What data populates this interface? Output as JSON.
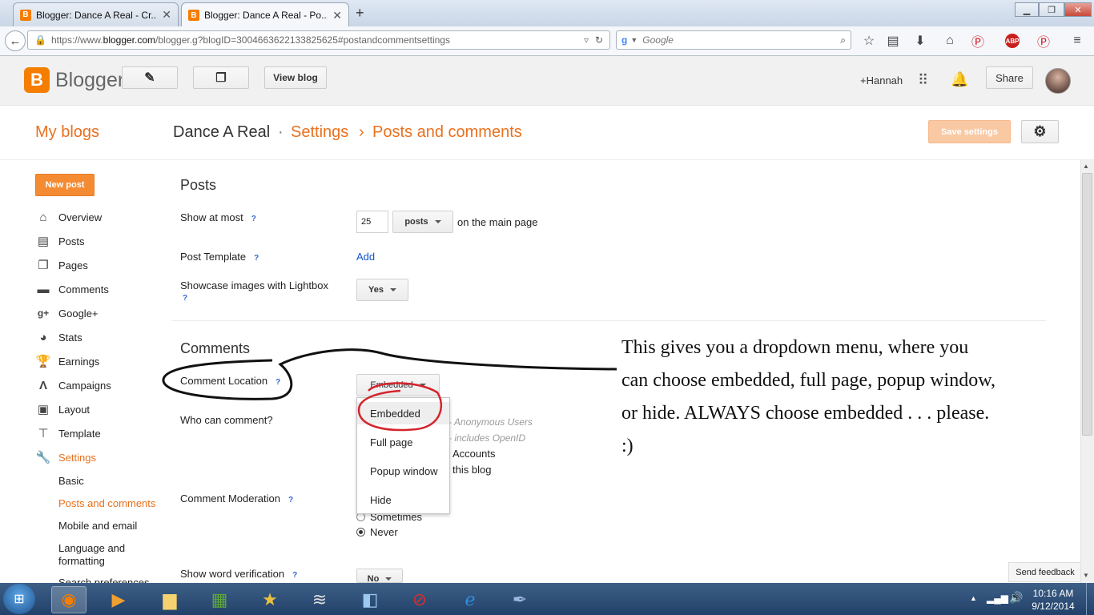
{
  "browser": {
    "tabs": [
      {
        "title": "Blogger: Dance A Real - Cr...",
        "active": false
      },
      {
        "title": "Blogger: Dance A Real - Po...",
        "active": true
      }
    ],
    "new_tab": "+",
    "url_prefix": "https://www.",
    "url_host": "blogger.com",
    "url_rest": "/blogger.g?blogID=3004663622133825625#postandcommentsettings",
    "search_placeholder": "Google"
  },
  "header": {
    "logo_letter": "B",
    "brand": "Blogger",
    "view_blog": "View blog",
    "user": "+Hannah",
    "share": "Share"
  },
  "title_row": {
    "my_blogs": "My blogs",
    "blog_name": "Dance A Real",
    "dot": "·",
    "settings": "Settings",
    "chev": "›",
    "page": "Posts and comments",
    "save": "Save settings"
  },
  "sidebar": {
    "new_post": "New post",
    "items": [
      {
        "label": "Overview",
        "icon": "home-icon"
      },
      {
        "label": "Posts",
        "icon": "posts-icon"
      },
      {
        "label": "Pages",
        "icon": "pages-icon"
      },
      {
        "label": "Comments",
        "icon": "comments-icon"
      },
      {
        "label": "Google+",
        "icon": "google-plus-icon"
      },
      {
        "label": "Stats",
        "icon": "stats-icon"
      },
      {
        "label": "Earnings",
        "icon": "trophy-icon"
      },
      {
        "label": "Campaigns",
        "icon": "campaigns-icon"
      },
      {
        "label": "Layout",
        "icon": "layout-icon"
      },
      {
        "label": "Template",
        "icon": "template-icon"
      },
      {
        "label": "Settings",
        "icon": "wrench-icon"
      }
    ],
    "subitems": [
      "Basic",
      "Posts and comments",
      "Mobile and email",
      "Language and",
      "formatting",
      "Search preferences"
    ]
  },
  "posts_section": {
    "heading": "Posts",
    "show_at_most": "Show at most",
    "show_value": "25",
    "show_unit": "posts",
    "show_suffix": "on the main page",
    "post_template": "Post Template",
    "add": "Add",
    "lightbox": "Showcase images with Lightbox",
    "lightbox_value": "Yes",
    "q": "?"
  },
  "comments_section": {
    "heading": "Comments",
    "location": "Comment Location",
    "location_value": "Embedded",
    "who": "Who can comment?",
    "who_options": [
      "- Anonymous Users",
      "- includes OpenID",
      "Accounts",
      "this blog"
    ],
    "moderation": "Comment Moderation",
    "moderation_options": [
      "Sometimes",
      "Never"
    ],
    "word_verification": "Show word verification",
    "word_value": "No"
  },
  "dropdown": {
    "items": [
      "Embedded",
      "Full page",
      "Popup window",
      "Hide"
    ]
  },
  "annotation": "This gives you a dropdown menu, where you can choose embedded, full page, popup window, or hide. ALWAYS choose embedded . . . please. :)",
  "feedback": "Send feedback",
  "taskbar": {
    "time": "10:16 AM",
    "date": "9/12/2014"
  },
  "colors": {
    "blogger_orange": "#f57d00",
    "link_orange": "#dd4b39",
    "link_blue": "#1155cc"
  }
}
